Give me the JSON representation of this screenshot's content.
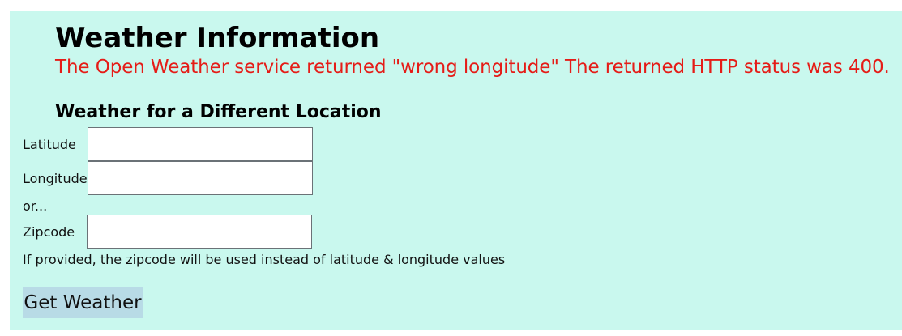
{
  "header": {
    "title": "Weather Information",
    "error_message": "The Open Weather service returned \"wrong longitude\" The returned HTTP status was 400."
  },
  "form": {
    "section_title": "Weather for a Different Location",
    "latitude_label": "Latitude",
    "latitude_value": "",
    "longitude_label": "Longitude",
    "longitude_value": "",
    "or_text": "or...",
    "zipcode_label": "Zipcode",
    "zipcode_value": "",
    "help_text": "If provided, the zipcode will be used instead of latitude & longitude values",
    "submit_label": "Get Weather"
  },
  "colors": {
    "panel_background": "#c9f8ee",
    "error_text": "#e51c17",
    "button_background": "#b8dbe6"
  }
}
